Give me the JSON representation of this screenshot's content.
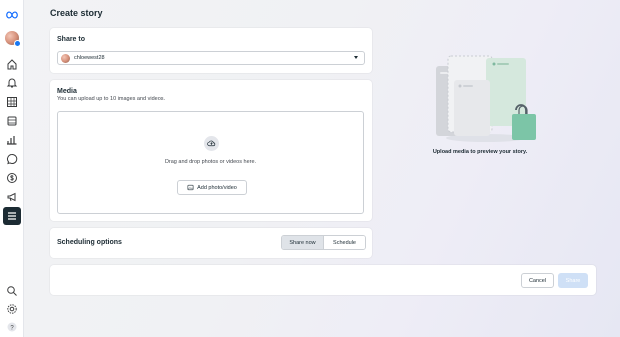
{
  "app": {
    "logo": "meta-logo"
  },
  "nav": {
    "icons": [
      "home-icon",
      "bell-icon",
      "grid-icon",
      "stack-icon",
      "chart-icon",
      "chat-icon",
      "dollar-icon",
      "megaphone-icon",
      "menu-icon"
    ],
    "bottom_icons": [
      "search-icon",
      "gear-icon",
      "help-icon"
    ]
  },
  "page": {
    "title": "Create story"
  },
  "share_to": {
    "heading": "Share to",
    "account": "chloewest28"
  },
  "media": {
    "heading": "Media",
    "subtext": "You can upload up to 10 images and videos.",
    "drag_text": "Drag and drop photos or videos here.",
    "add_button": "Add photo/video"
  },
  "scheduling": {
    "heading": "Scheduling options",
    "options": [
      "Share now",
      "Schedule"
    ],
    "selected": "Share now"
  },
  "footer": {
    "cancel": "Cancel",
    "share": "Share"
  },
  "preview": {
    "text": "Upload media to preview your story."
  },
  "colors": {
    "accent": "#1877f2",
    "share_disabled": "#cfe0f6",
    "nav_active": "#1c2b33"
  }
}
